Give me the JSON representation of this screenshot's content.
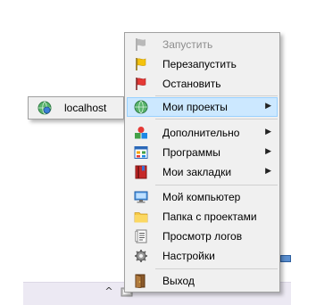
{
  "context_menu": {
    "items": [
      {
        "label": "Запустить",
        "icon": "flag-gray-icon",
        "enabled": false
      },
      {
        "label": "Перезапустить",
        "icon": "flag-yellow-icon",
        "enabled": true
      },
      {
        "label": "Остановить",
        "icon": "flag-red-icon",
        "enabled": true
      },
      {
        "label": "Мои проекты",
        "icon": "globe-icon",
        "enabled": true,
        "submenu": true,
        "highlighted": true
      },
      {
        "label": "Дополнительно",
        "icon": "shapes-icon",
        "enabled": true,
        "submenu": true
      },
      {
        "label": "Программы",
        "icon": "window-grid-icon",
        "enabled": true,
        "submenu": true
      },
      {
        "label": "Мои закладки",
        "icon": "bookmarks-icon",
        "enabled": true,
        "submenu": true
      },
      {
        "label": "Мой компьютер",
        "icon": "computer-icon",
        "enabled": true
      },
      {
        "label": "Папка с проектами",
        "icon": "folder-icon",
        "enabled": true
      },
      {
        "label": "Просмотр логов",
        "icon": "log-icon",
        "enabled": true
      },
      {
        "label": "Настройки",
        "icon": "gear-icon",
        "enabled": true
      },
      {
        "label": "Выход",
        "icon": "exit-door-icon",
        "enabled": true
      }
    ]
  },
  "projects_submenu": {
    "items": [
      {
        "label": "localhost",
        "icon": "globe-icon"
      }
    ]
  },
  "taskbar": {
    "tray_chevron": "^"
  },
  "colors": {
    "menu_bg": "#f0f0f0",
    "highlight_bg": "#cce8ff",
    "highlight_border": "#99d1ff",
    "disabled_text": "#8d8d8d"
  }
}
